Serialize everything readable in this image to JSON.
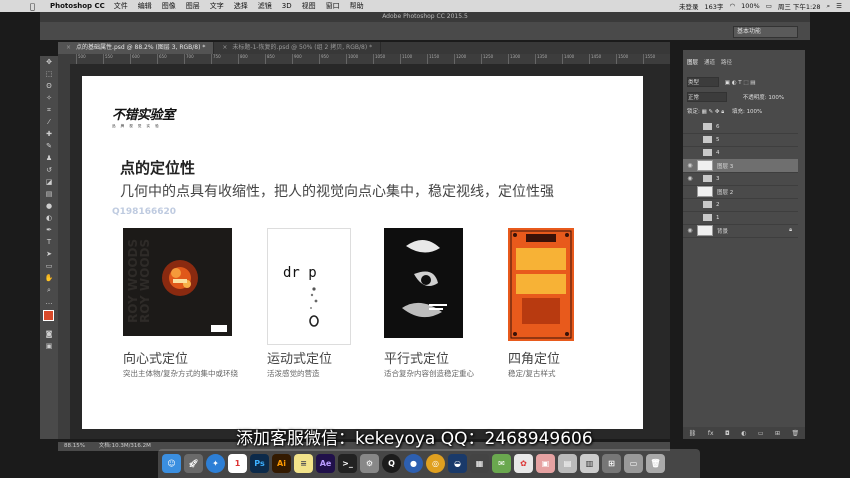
{
  "menubar": {
    "app": "Photoshop CC",
    "items": [
      "文件",
      "编辑",
      "图像",
      "图层",
      "文字",
      "选择",
      "滤镜",
      "3D",
      "视图",
      "窗口",
      "帮助"
    ],
    "status_right": [
      "未登录",
      "163字",
      "100%",
      "周三 下午1:28"
    ]
  },
  "window": {
    "title": "Adobe Photoshop CC 2015.5"
  },
  "optbar": {
    "workspace": "基本功能"
  },
  "tabs": [
    {
      "label": "点的基础属性.psd @ 88.2% (图层 3, RGB/8) *"
    },
    {
      "label": "未标题-1-恢复的.psd @ 50% (组 2 拷贝, RGB/8) *"
    }
  ],
  "ruler": [
    "500",
    "550",
    "600",
    "650",
    "700",
    "750",
    "800",
    "850",
    "900",
    "950",
    "1000",
    "1050",
    "1100",
    "1150",
    "1200",
    "1250",
    "1300",
    "1350",
    "1400",
    "1450",
    "1500",
    "1550"
  ],
  "doc": {
    "logo": "不错实验室",
    "logo_sub": "品 牌 视 觉 实 验",
    "heading": "点的定位性",
    "description": "几何中的点具有收缩性，把人的视觉向点心集中，稳定视线，定位性强",
    "watermark": "Q198166620",
    "cards": [
      {
        "title": "向心式定位",
        "sub": "突出主体物/复杂方式的集中或环绕",
        "poster_text": "ROY WOODS"
      },
      {
        "title": "运动式定位",
        "sub": "活泼感觉的营造",
        "poster_text": "dr  p"
      },
      {
        "title": "平行式定位",
        "sub": "适合复杂内容创造稳定重心",
        "poster_text": ""
      },
      {
        "title": "四角定位",
        "sub": "稳定/复古样式",
        "poster_text": ""
      }
    ]
  },
  "layers_panel": {
    "tabs": [
      "图层",
      "通道",
      "路径"
    ],
    "kind": "类型",
    "blend": "正常",
    "opacity_label": "不透明度:",
    "opacity": "100%",
    "lock_label": "锁定:",
    "fill_label": "填充:",
    "fill": "100%",
    "layers": [
      {
        "name": "6",
        "type": "group"
      },
      {
        "name": "5",
        "type": "group"
      },
      {
        "name": "4",
        "type": "group"
      },
      {
        "name": "图层 3",
        "type": "layer",
        "selected": true
      },
      {
        "name": "3",
        "type": "group"
      },
      {
        "name": "图层 2",
        "type": "layer"
      },
      {
        "name": "2",
        "type": "group"
      },
      {
        "name": "1",
        "type": "group"
      },
      {
        "name": "背景",
        "type": "layer"
      }
    ]
  },
  "status": {
    "zoom": "88.15%",
    "doc": "文档:10.3M/316.2M"
  },
  "subtitle": "添加客服微信：kekeyoya   QQ：2468949606",
  "dock": [
    "finder",
    "launchpad",
    "safari",
    "calendar",
    "Ps",
    "Ai",
    "notes",
    "Ae",
    "terminal",
    "settings",
    "quicktime",
    "chrome",
    "wechat",
    "photos",
    "music",
    "app",
    "app",
    "trash"
  ]
}
